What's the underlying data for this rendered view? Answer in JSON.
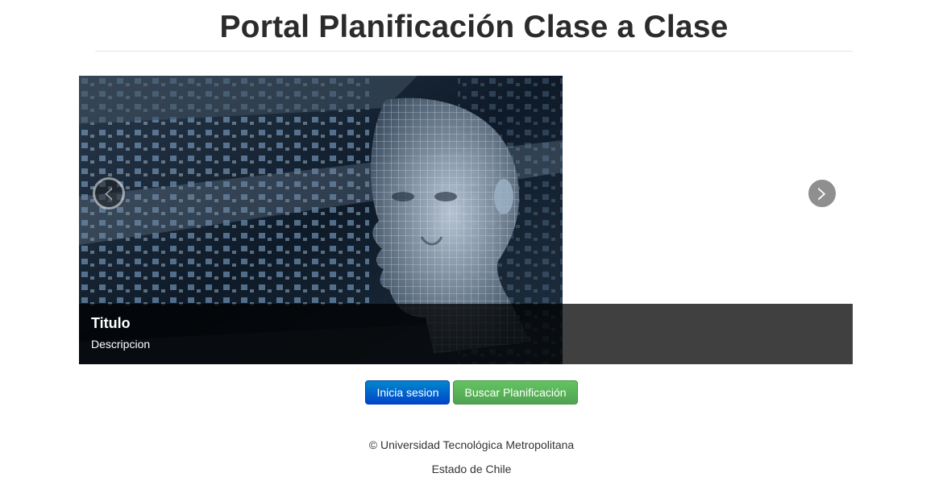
{
  "header": {
    "title": "Portal Planificación Clase a Clase"
  },
  "carousel": {
    "slide": {
      "image": "wireframe-head-digital-matrix",
      "caption_title": "Titulo",
      "caption_description": "Descripcion"
    },
    "prev_icon": "‹",
    "next_icon": "›"
  },
  "actions": {
    "login_label": "Inicia sesion",
    "search_label": "Buscar Planificación"
  },
  "footer": {
    "copyright": "© Universidad Tecnológica Metropolitana",
    "line2": "Estado de Chile"
  },
  "colors": {
    "primary_button": "#0055cc",
    "success_button": "#5bb75b",
    "caption_background": "#3f3f3f"
  }
}
